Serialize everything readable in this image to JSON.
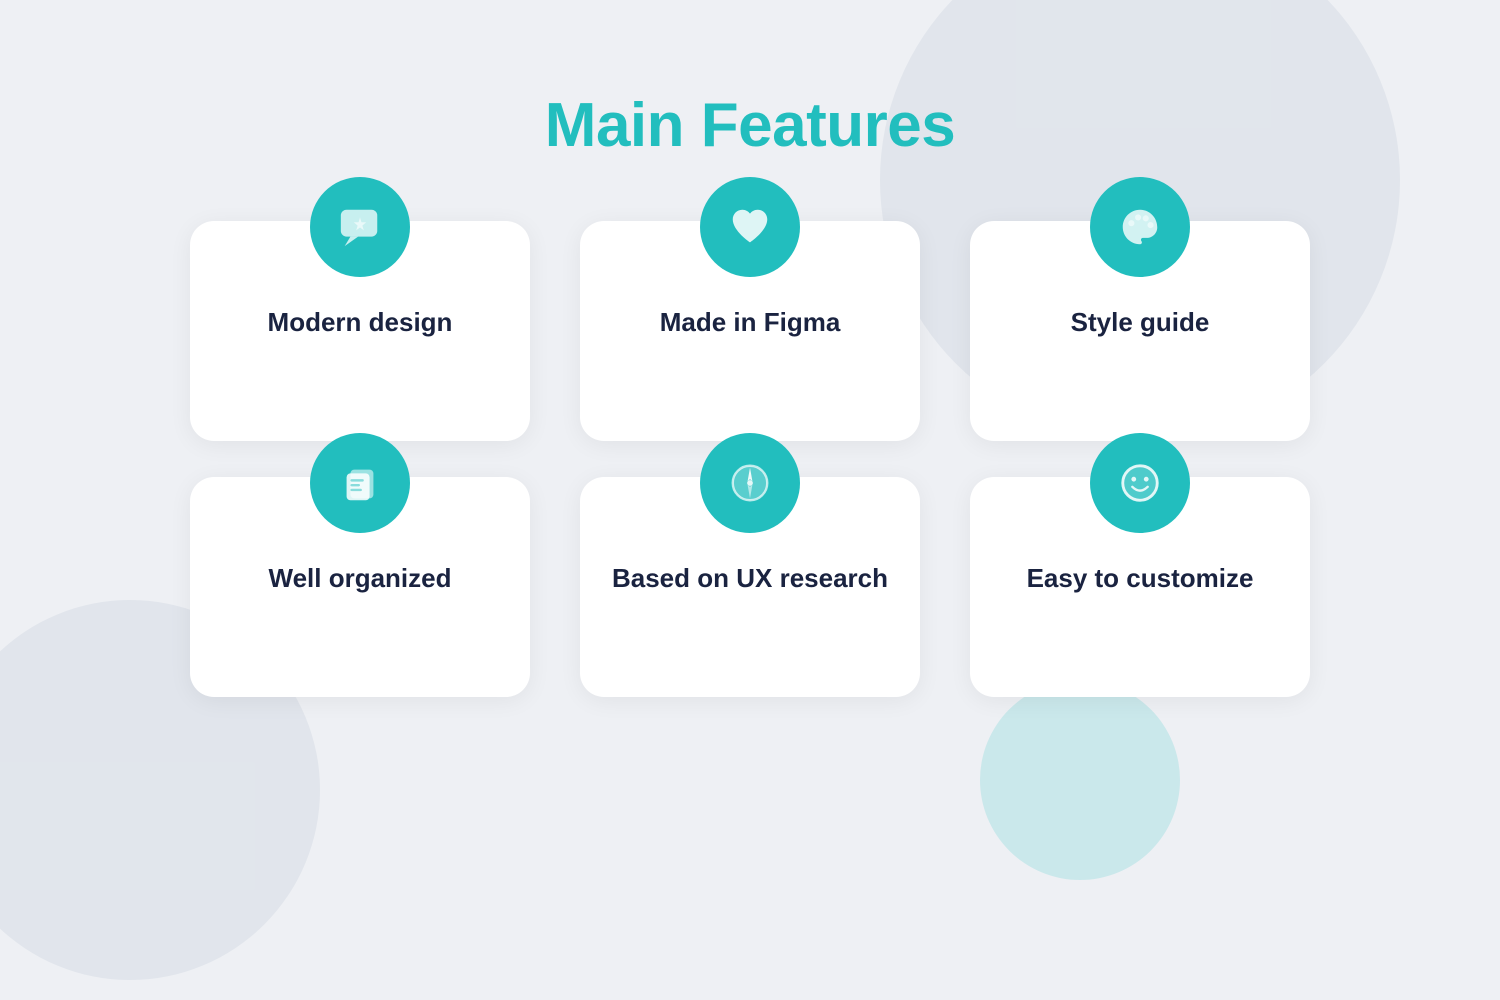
{
  "page": {
    "title": "Main Features",
    "background_color": "#eef0f4",
    "accent_color": "#22bebe"
  },
  "features": [
    {
      "id": "modern-design",
      "label": "Modern design",
      "icon": "sparkle-chat"
    },
    {
      "id": "made-in-figma",
      "label": "Made in Figma",
      "icon": "heart"
    },
    {
      "id": "style-guide",
      "label": "Style guide",
      "icon": "palette"
    },
    {
      "id": "well-organized",
      "label": "Well organized",
      "icon": "documents"
    },
    {
      "id": "ux-research",
      "label": "Based  on UX research",
      "icon": "compass"
    },
    {
      "id": "easy-customize",
      "label": "Easy to customize",
      "icon": "smiley"
    }
  ]
}
